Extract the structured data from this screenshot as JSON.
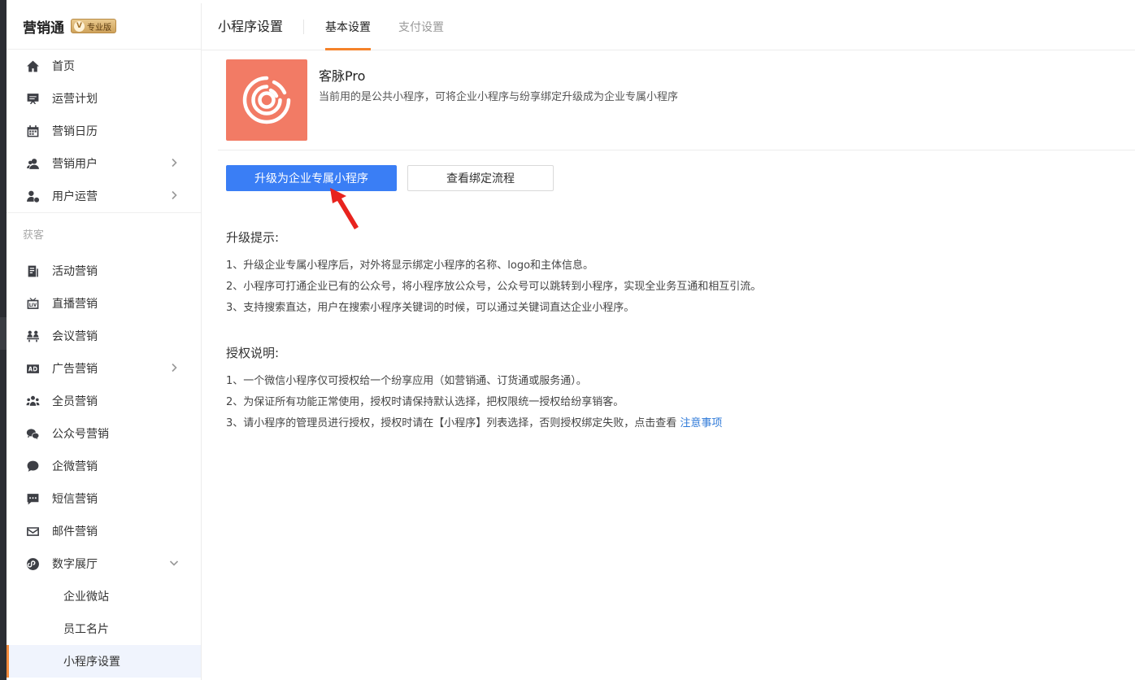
{
  "brand": {
    "name": "营销通",
    "badge_letter": "V",
    "badge_text": "专业版"
  },
  "sidebar": {
    "items": [
      {
        "label": "首页",
        "icon": "home-icon",
        "chevron": false
      },
      {
        "label": "运营计划",
        "icon": "presentation-icon",
        "chevron": false
      },
      {
        "label": "营销日历",
        "icon": "calendar-icon",
        "chevron": false
      },
      {
        "label": "营销用户",
        "icon": "users-icon",
        "chevron": true
      },
      {
        "label": "用户运营",
        "icon": "user-gear-icon",
        "chevron": true
      }
    ],
    "section_label": "获客",
    "items2": [
      {
        "label": "活动营销",
        "icon": "document-icon",
        "chevron": false
      },
      {
        "label": "直播营销",
        "icon": "live-icon",
        "chevron": false
      },
      {
        "label": "会议营销",
        "icon": "meeting-icon",
        "chevron": false
      },
      {
        "label": "广告营销",
        "icon": "ad-icon",
        "chevron": true
      },
      {
        "label": "全员营销",
        "icon": "team-icon",
        "chevron": false
      },
      {
        "label": "公众号营销",
        "icon": "wechat-icon",
        "chevron": false
      },
      {
        "label": "企微营销",
        "icon": "chat-icon",
        "chevron": false
      },
      {
        "label": "短信营销",
        "icon": "sms-icon",
        "chevron": false
      },
      {
        "label": "邮件营销",
        "icon": "mail-icon",
        "chevron": false
      },
      {
        "label": "数字展厅",
        "icon": "showroom-icon",
        "chevron": "down"
      }
    ],
    "sub_items": [
      {
        "label": "企业微站",
        "active": false
      },
      {
        "label": "员工名片",
        "active": false
      },
      {
        "label": "小程序设置",
        "active": true
      }
    ]
  },
  "header": {
    "title": "小程序设置",
    "tabs": [
      {
        "label": "基本设置",
        "active": true
      },
      {
        "label": "支付设置",
        "active": false
      }
    ]
  },
  "app": {
    "name": "客脉Pro",
    "description": "当前用的是公共小程序，可将企业小程序与纷享绑定升级成为企业专属小程序",
    "card_color": "#f27b65"
  },
  "actions": {
    "upgrade_label": "升级为企业专属小程序",
    "view_flow_label": "查看绑定流程"
  },
  "tips": {
    "title": "升级提示:",
    "lines": [
      "1、升级企业专属小程序后，对外将显示绑定小程序的名称、logo和主体信息。",
      "2、小程序可打通企业已有的公众号，将小程序放公众号，公众号可以跳转到小程序，实现全业务互通和相互引流。",
      "3、支持搜索直达，用户在搜索小程序关键词的时候，可以通过关键词直达企业小程序。"
    ]
  },
  "auth": {
    "title": "授权说明:",
    "lines": [
      "1、一个微信小程序仅可授权给一个纷享应用（如营销通、订货通或服务通）。",
      "2、为保证所有功能正常使用，授权时请保持默认选择，把权限统一授权给纷享销客。",
      "3、请小程序的管理员进行授权，授权时请在【小程序】列表选择，否则授权绑定失败，点击查看"
    ],
    "link_text": "注意事项"
  },
  "colors": {
    "primary": "#3a7ef5",
    "accent": "#f5822a",
    "link": "#2f7ad8",
    "arrow": "#e8231e"
  }
}
